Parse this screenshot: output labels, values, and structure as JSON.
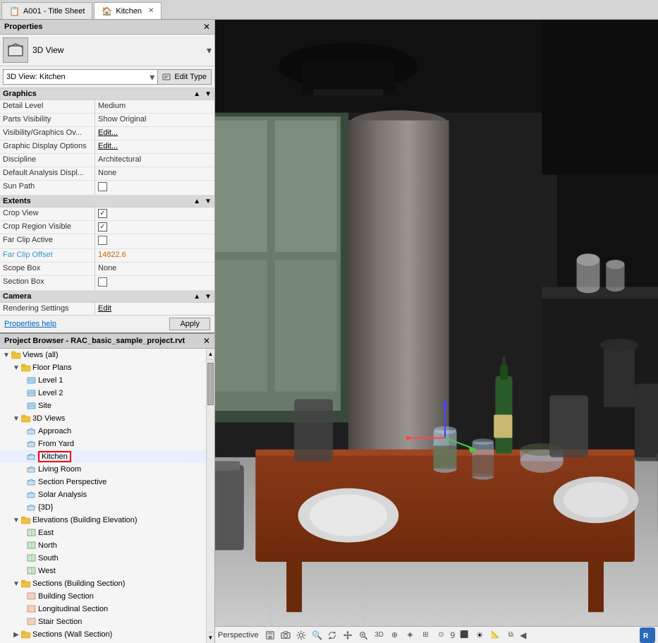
{
  "tabs": [
    {
      "id": "title-sheet",
      "icon": "📋",
      "label": "A001 - Title Sheet",
      "closeable": false,
      "active": false
    },
    {
      "id": "kitchen",
      "icon": "🏠",
      "label": "Kitchen",
      "closeable": true,
      "active": true
    }
  ],
  "properties_panel": {
    "title": "Properties",
    "view_type_label": "3D View",
    "view_name": "3D View: Kitchen",
    "edit_type_label": "Edit Type",
    "sections": [
      {
        "name": "Graphics",
        "rows": [
          {
            "name": "Detail Level",
            "value": "Medium",
            "type": "text"
          },
          {
            "name": "Parts Visibility",
            "value": "Show Original",
            "type": "text"
          },
          {
            "name": "Visibility/Graphics Ov...",
            "value": "Edit...",
            "type": "edit-btn"
          },
          {
            "name": "Graphic Display Options",
            "value": "Edit...",
            "type": "edit-btn"
          },
          {
            "name": "Discipline",
            "value": "Architectural",
            "type": "text"
          },
          {
            "name": "Default Analysis Displ...",
            "value": "None",
            "type": "text"
          },
          {
            "name": "Sun Path",
            "value": "",
            "type": "checkbox",
            "checked": false
          }
        ]
      },
      {
        "name": "Extents",
        "rows": [
          {
            "name": "Crop View",
            "value": "",
            "type": "checkbox",
            "checked": true
          },
          {
            "name": "Crop Region Visible",
            "value": "",
            "type": "checkbox",
            "checked": true
          },
          {
            "name": "Far Clip Active",
            "value": "",
            "type": "checkbox",
            "checked": false
          },
          {
            "name": "Far Clip Offset",
            "value": "14822.6",
            "type": "orange"
          },
          {
            "name": "Scope Box",
            "value": "None",
            "type": "text"
          },
          {
            "name": "Section Box",
            "value": "",
            "type": "checkbox",
            "checked": false
          }
        ]
      },
      {
        "name": "Camera",
        "rows": [
          {
            "name": "Rendering Settings",
            "value": "Edit",
            "type": "edit-btn"
          }
        ]
      }
    ],
    "help_link": "Properties help",
    "apply_label": "Apply"
  },
  "project_browser": {
    "title": "Project Browser - RAC_basic_sample_project.rvt",
    "tree": {
      "root_label": "Views (all)",
      "items": [
        {
          "label": "Floor Plans",
          "expanded": true,
          "children": [
            {
              "label": "Level 1"
            },
            {
              "label": "Level 2"
            },
            {
              "label": "Site"
            }
          ]
        },
        {
          "label": "3D Views",
          "expanded": true,
          "children": [
            {
              "label": "Approach"
            },
            {
              "label": "From Yard"
            },
            {
              "label": "Kitchen",
              "selected": true,
              "highlighted": true
            },
            {
              "label": "Living Room"
            },
            {
              "label": "Section Perspective"
            },
            {
              "label": "Solar Analysis"
            },
            {
              "label": "{3D}"
            }
          ]
        },
        {
          "label": "Elevations (Building Elevation)",
          "expanded": true,
          "children": [
            {
              "label": "East"
            },
            {
              "label": "North"
            },
            {
              "label": "South"
            },
            {
              "label": "West"
            }
          ]
        },
        {
          "label": "Sections (Building Section)",
          "expanded": true,
          "children": [
            {
              "label": "Building Section"
            },
            {
              "label": "Longitudinal Section"
            },
            {
              "label": "Stair Section"
            }
          ]
        },
        {
          "label": "Sections (Wall Section)",
          "expanded": false,
          "children": []
        }
      ]
    }
  },
  "viewport": {
    "title": "Kitchen"
  },
  "statusbar": {
    "perspective_label": "Perspective",
    "icons": [
      "save",
      "camera",
      "settings",
      "zoom-in",
      "zoom-out",
      "pan",
      "orbit",
      "section",
      "render",
      "sun",
      "grid",
      "measure",
      "arrow-left"
    ]
  }
}
